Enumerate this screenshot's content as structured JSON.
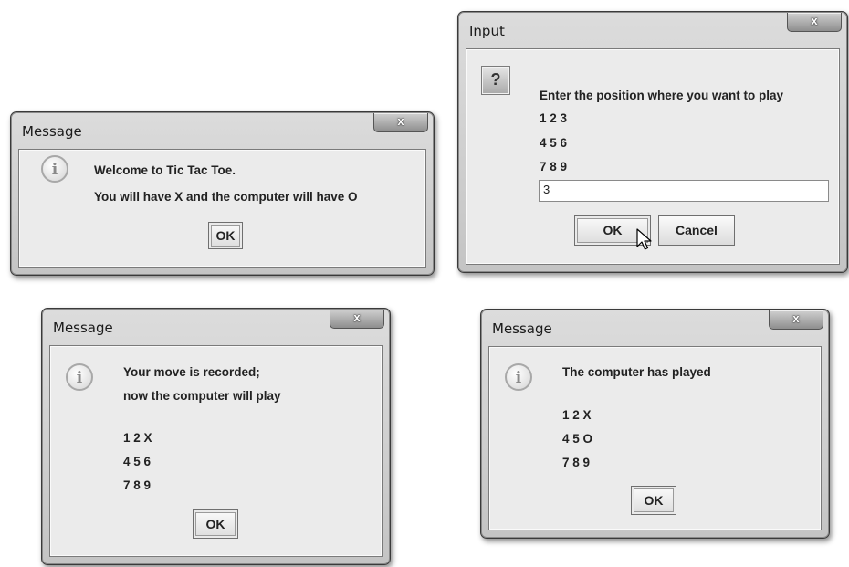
{
  "dialog1": {
    "title": "Message",
    "close": "x",
    "icon": "info-icon",
    "line1": "Welcome to Tic Tac Toe.",
    "line2": "You will have X and the computer will have O",
    "ok": "OK"
  },
  "dialog2": {
    "title": "Input",
    "close": "x",
    "icon": "question-icon",
    "prompt": "Enter the position where you want to play",
    "row1": "1 2 3",
    "row2": "4 5 6",
    "row3": "7 8 9",
    "input_value": "3",
    "ok": "OK",
    "cancel": "Cancel"
  },
  "dialog3": {
    "title": "Message",
    "close": "x",
    "icon": "info-icon",
    "line1": "Your move is recorded;",
    "line2": "now the computer will play",
    "row1": "1 2 X",
    "row2": "4 5 6",
    "row3": "7 8 9",
    "ok": "OK"
  },
  "dialog4": {
    "title": "Message",
    "close": "x",
    "icon": "info-icon",
    "line1": "The computer has played",
    "row1": "1 2 X",
    "row2": "4 5 O",
    "row3": "7 8 9",
    "ok": "OK"
  }
}
